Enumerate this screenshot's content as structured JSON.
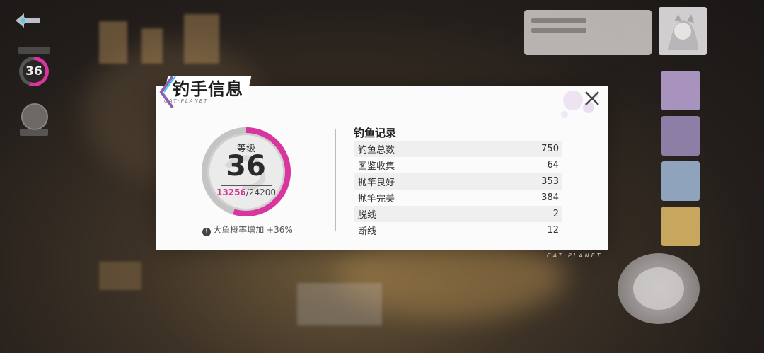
{
  "dialog": {
    "title": "钓手信息",
    "subtitle": "CAT·PLANET",
    "close_icon": "close-icon"
  },
  "level": {
    "label": "等级",
    "value": "36",
    "exp_current": "13256",
    "exp_max": "/24200",
    "progress": 0.548,
    "ring_color": "#d9359f",
    "bonus_text": "大鱼概率增加 +36%",
    "bonus_icon": "info-icon"
  },
  "records": {
    "title": "钓鱼记录",
    "rows": [
      {
        "label": "钓鱼总数",
        "value": "750"
      },
      {
        "label": "图鉴收集",
        "value": "64"
      },
      {
        "label": "抛竿良好",
        "value": "353"
      },
      {
        "label": "抛竿完美",
        "value": "384"
      },
      {
        "label": "脱线",
        "value": "2"
      },
      {
        "label": "断线",
        "value": "12"
      }
    ]
  },
  "hud": {
    "level_value": "36",
    "brand": "CAT·PLANET",
    "back_icon": "back-arrow-icon"
  }
}
